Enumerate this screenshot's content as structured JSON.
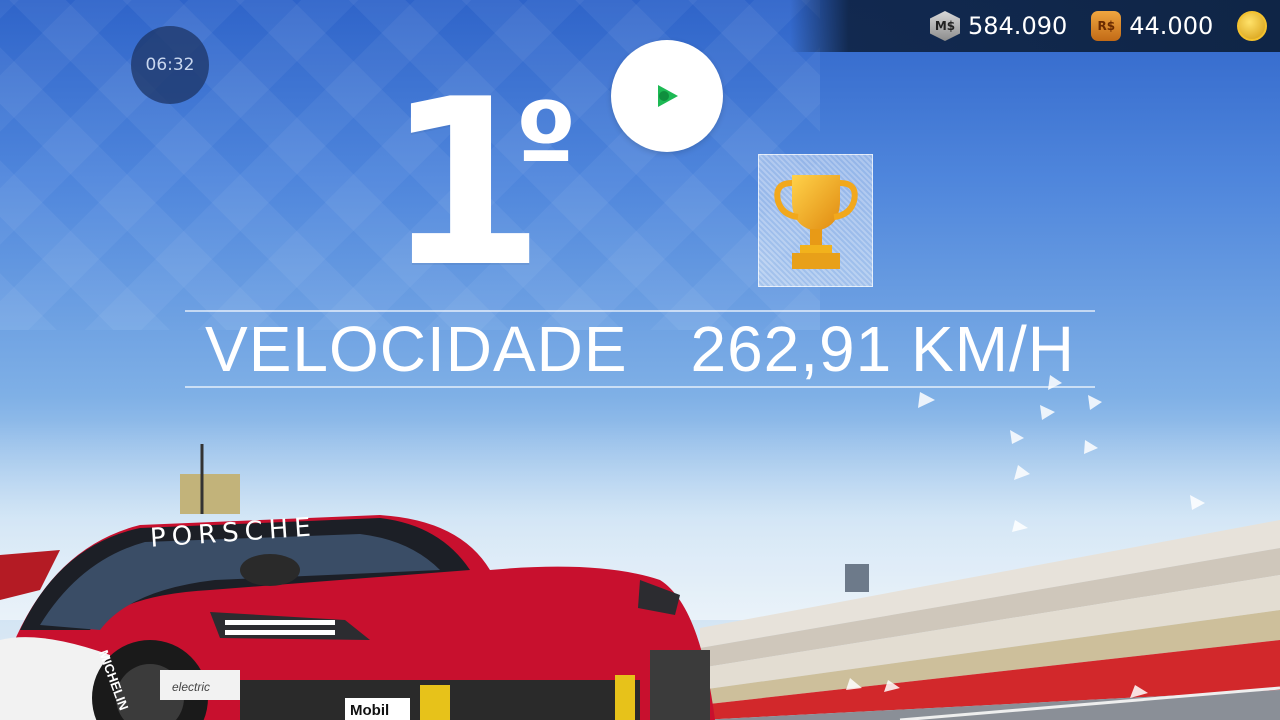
{
  "hud": {
    "timer": "06:32",
    "currencies": [
      {
        "icon": "m-dollar-icon",
        "symbol": "M$",
        "amount": "584.090"
      },
      {
        "icon": "r-dollar-icon",
        "symbol": "R$",
        "amount": "44.000"
      },
      {
        "icon": "gold-coin-icon"
      }
    ]
  },
  "result": {
    "position_number": "1",
    "position_suffix": "º",
    "speed_label": "VELOCIDADE",
    "speed_value": "262,91 KM/H"
  },
  "car": {
    "brand_text": "PORSCHE",
    "sponsor": "Mobil",
    "tire_brand": "MICHELIN",
    "badge_text": "electric"
  },
  "colors": {
    "hud_bar": "#0f2546",
    "car_red": "#c8102e",
    "trophy_gold": "#f2b21c",
    "record_green": "#1db954"
  }
}
